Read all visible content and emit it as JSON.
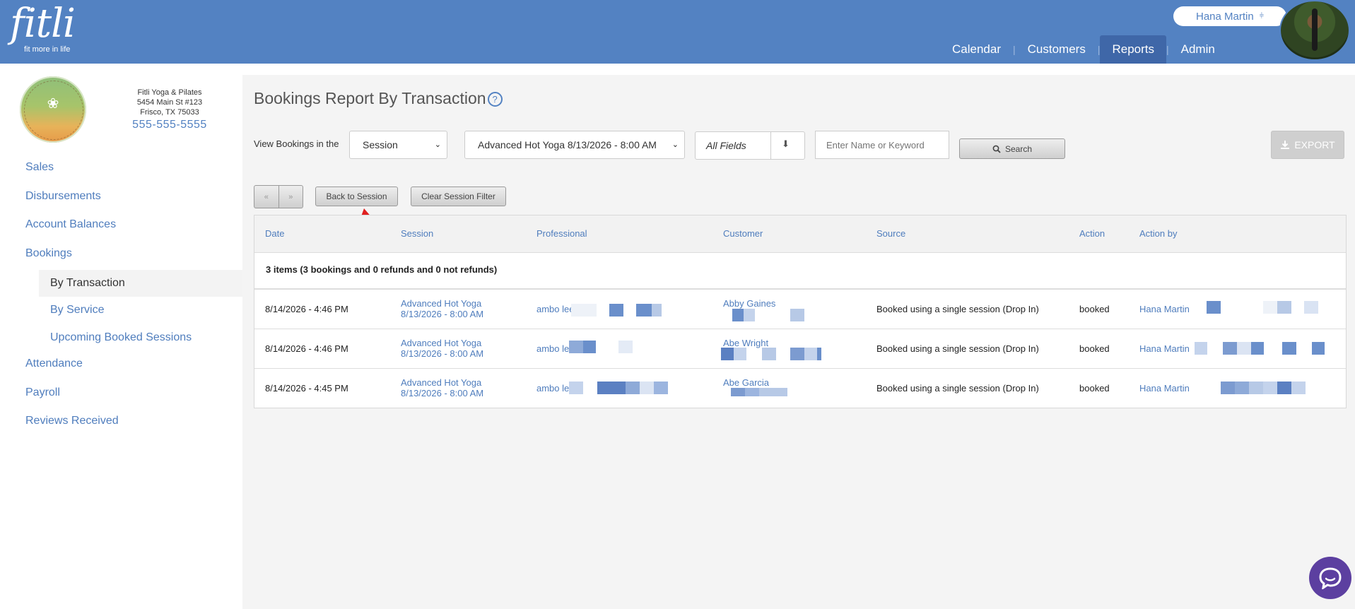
{
  "brand": {
    "name": "fitli",
    "tagline": "fit more in life"
  },
  "user": {
    "name": "Hana Martin"
  },
  "nav": [
    {
      "label": "Calendar"
    },
    {
      "label": "Customers"
    },
    {
      "label": "Reports",
      "active": true
    },
    {
      "label": "Admin"
    }
  ],
  "studio": {
    "name": "Fitli Yoga & Pilates",
    "address1": "5454 Main St #123",
    "address2": "Frisco, TX 75033",
    "phone": "555-555-5555"
  },
  "sidebar": {
    "items": [
      {
        "label": "Sales"
      },
      {
        "label": "Disbursements"
      },
      {
        "label": "Account Balances"
      },
      {
        "label": "Bookings"
      },
      {
        "label": "Attendance"
      },
      {
        "label": "Payroll"
      },
      {
        "label": "Reviews Received"
      }
    ],
    "sub": [
      {
        "label": "By Transaction",
        "active": true
      },
      {
        "label": "By Service"
      },
      {
        "label": "Upcoming Booked Sessions"
      }
    ]
  },
  "page": {
    "title": "Bookings Report By Transaction",
    "help": "?"
  },
  "filters": {
    "label": "View Bookings in the",
    "scope": "Session",
    "session": "Advanced Hot Yoga 8/13/2026 - 8:00 AM",
    "fields": "All Fields",
    "keyword_placeholder": "Enter Name or Keyword",
    "search_label": "Search",
    "export_label": "EXPORT"
  },
  "pager": {
    "prev": "«",
    "next": "»"
  },
  "buttons": {
    "back": "Back to Session",
    "clear": "Clear Session Filter"
  },
  "table": {
    "columns": [
      "Date",
      "Session",
      "Professional",
      "Customer",
      "Source",
      "Action",
      "Action by"
    ],
    "summary": "3 items (3 bookings and 0 refunds and 0 not refunds)",
    "rows": [
      {
        "date": "8/14/2026 - 4:46 PM",
        "session_line1": "Advanced Hot Yoga",
        "session_line2": "8/13/2026 - 8:00 AM",
        "professional": "ambo lee",
        "customer": "Abby Gaines",
        "source": "Booked using a single session (Drop In)",
        "action": "booked",
        "action_by": "Hana Martin"
      },
      {
        "date": "8/14/2026 - 4:46 PM",
        "session_line1": "Advanced Hot Yoga",
        "session_line2": "8/13/2026 - 8:00 AM",
        "professional": "ambo lee",
        "customer": "Abe Wright",
        "source": "Booked using a single session (Drop In)",
        "action": "booked",
        "action_by": "Hana Martin"
      },
      {
        "date": "8/14/2026 - 4:45 PM",
        "session_line1": "Advanced Hot Yoga",
        "session_line2": "8/13/2026 - 8:00 AM",
        "professional": "ambo lee",
        "customer": "Abe Garcia",
        "source": "Booked using a single session (Drop In)",
        "action": "booked",
        "action_by": "Hana Martin"
      }
    ]
  },
  "colors": {
    "header": "#5382c2",
    "link": "#4f7dbd",
    "chat": "#5c3fa0"
  }
}
